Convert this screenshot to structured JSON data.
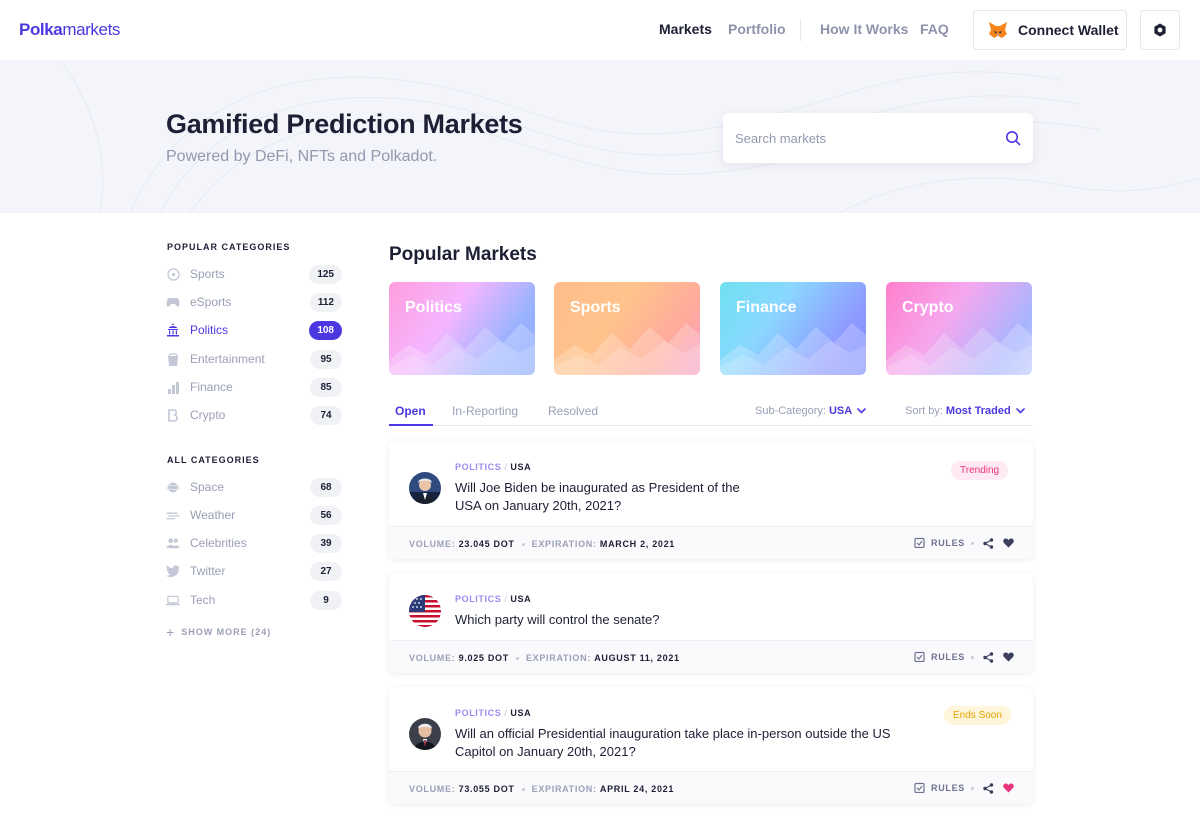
{
  "header": {
    "logo_bold": "Polka",
    "logo_light": "markets",
    "nav": [
      "Markets",
      "Portfolio",
      "How It Works",
      "FAQ"
    ],
    "connect_wallet": "Connect Wallet"
  },
  "hero": {
    "title": "Gamified Prediction Markets",
    "subtitle": "Powered by DeFi, NFTs and Polkadot.",
    "search_placeholder": "Search markets"
  },
  "sidebar": {
    "popular_heading": "POPULAR CATEGORIES",
    "popular": [
      {
        "label": "Sports",
        "count": "125",
        "icon": "sports-icon"
      },
      {
        "label": "eSports",
        "count": "112",
        "icon": "gamepad-icon"
      },
      {
        "label": "Politics",
        "count": "108",
        "icon": "capitol-icon",
        "active": true
      },
      {
        "label": "Entertainment",
        "count": "95",
        "icon": "entertainment-icon"
      },
      {
        "label": "Finance",
        "count": "85",
        "icon": "finance-icon"
      },
      {
        "label": "Crypto",
        "count": "74",
        "icon": "bitcoin-icon"
      }
    ],
    "all_heading": "ALL CATEGORIES",
    "all": [
      {
        "label": "Space",
        "count": "68",
        "icon": "planet-icon"
      },
      {
        "label": "Weather",
        "count": "56",
        "icon": "weather-icon"
      },
      {
        "label": "Celebrities",
        "count": "39",
        "icon": "people-icon"
      },
      {
        "label": "Twitter",
        "count": "27",
        "icon": "twitter-icon"
      },
      {
        "label": "Tech",
        "count": "9",
        "icon": "laptop-icon"
      }
    ],
    "show_more": "SHOW MORE (24)"
  },
  "main": {
    "popular_title": "Popular Markets",
    "popular_cards": [
      "Politics",
      "Sports",
      "Finance",
      "Crypto"
    ],
    "tabs": [
      "Open",
      "In-Reporting",
      "Resolved"
    ],
    "subcategory_label": "Sub-Category:",
    "subcategory_value": "USA",
    "sort_label": "Sort by:",
    "sort_value": "Most Traded",
    "markets": [
      {
        "category": "POLITICS",
        "subcategory": "USA",
        "question_line1": "Will Joe Biden be inaugurated as President of the",
        "question_line2": "USA on January 20th, 2021?",
        "badge": "Trending",
        "volume_label": "VOLUME:",
        "volume": "23.045 DOT",
        "expiration_label": "EXPIRATION:",
        "expiration": "MARCH 2, 2021",
        "rules": "RULES",
        "favorited": false
      },
      {
        "category": "POLITICS",
        "subcategory": "USA",
        "question_line1": "Which party will control the senate?",
        "question_line2": "",
        "badge": "",
        "volume_label": "VOLUME:",
        "volume": "9.025 DOT",
        "expiration_label": "EXPIRATION:",
        "expiration": "AUGUST 11, 2021",
        "rules": "RULES",
        "favorited": false
      },
      {
        "category": "POLITICS",
        "subcategory": "USA",
        "question_line1": "Will an official Presidential inauguration take place in-person outside the US",
        "question_line2": "Capitol on January 20th, 2021?",
        "badge": "Ends Soon",
        "volume_label": "VOLUME:",
        "volume": "73.055 DOT",
        "expiration_label": "EXPIRATION:",
        "expiration": "APRIL 24, 2021",
        "rules": "RULES",
        "favorited": true
      }
    ]
  },
  "colors": {
    "accent": "#4b38e0",
    "trending": "#e8357e",
    "ends_soon": "#e2a500",
    "favorite": "#e8357e"
  }
}
